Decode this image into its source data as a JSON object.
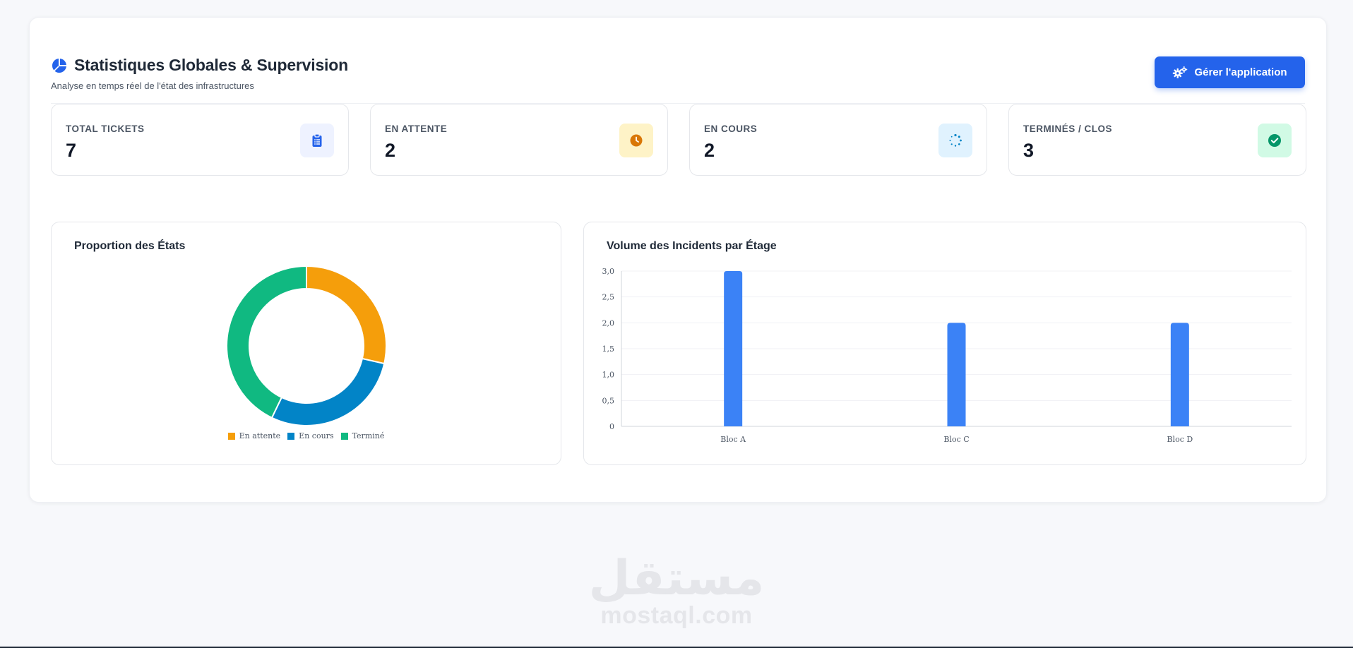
{
  "header": {
    "title": "Statistiques Globales & Supervision",
    "subtitle": "Analyse en temps réel de l'état des infrastructures",
    "manage_button": "Gérer l'application",
    "icon": "chart-pie-icon"
  },
  "stats": [
    {
      "label": "TOTAL TICKETS",
      "value": "7",
      "icon": "clipboard-list-icon",
      "icon_color": "#2563eb",
      "icon_bg": "#eef2ff"
    },
    {
      "label": "EN ATTENTE",
      "value": "2",
      "icon": "clock-icon",
      "icon_color": "#d97706",
      "icon_bg": "#fef3c7"
    },
    {
      "label": "EN COURS",
      "value": "2",
      "icon": "spinner-icon",
      "icon_color": "#0284c7",
      "icon_bg": "#e0f2fe"
    },
    {
      "label": "TERMINÉS / CLOS",
      "value": "3",
      "icon": "check-circle-icon",
      "icon_color": "#059669",
      "icon_bg": "#d1fae5"
    }
  ],
  "colors": {
    "accent": "#2463eb",
    "pending": "#f59e0b",
    "in_progress": "#0284c7",
    "done": "#10b981",
    "bar": "#3b82f6"
  },
  "chart_data": [
    {
      "type": "pie",
      "title": "Proportion des États",
      "donut": true,
      "categories": [
        "En attente",
        "En cours",
        "Terminé"
      ],
      "values": [
        2,
        2,
        3
      ],
      "colors": [
        "#f59e0b",
        "#0284c7",
        "#10b981"
      ],
      "legend": "bottom"
    },
    {
      "type": "bar",
      "title": "Volume des Incidents par Étage",
      "categories": [
        "Bloc A",
        "Bloc C",
        "Bloc D"
      ],
      "values": [
        3,
        2,
        2
      ],
      "ylim": [
        0,
        3
      ],
      "yticks": [
        "0",
        "0,5",
        "1,0",
        "1,5",
        "2,0",
        "2,5",
        "3,0"
      ],
      "grid": true,
      "color": "#3b82f6"
    }
  ],
  "watermark": {
    "arabic": "مستقل",
    "latin": "mostaql.com"
  }
}
